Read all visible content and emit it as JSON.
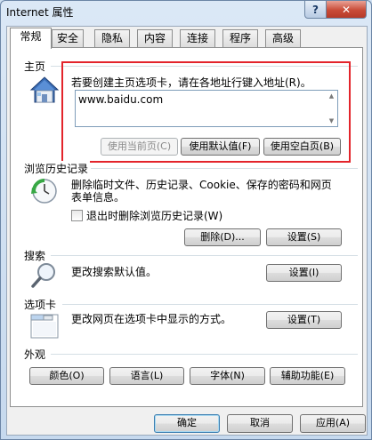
{
  "window": {
    "title": "Internet 属性",
    "help_label": "?",
    "close_label": "✕"
  },
  "tabs": [
    {
      "label": "常规",
      "active": true
    },
    {
      "label": "安全"
    },
    {
      "label": "隐私"
    },
    {
      "label": "内容"
    },
    {
      "label": "连接"
    },
    {
      "label": "程序"
    },
    {
      "label": "高级"
    }
  ],
  "home": {
    "section_label": "主页",
    "hint": "若要创建主页选项卡，请在各地址行键入地址(R)。",
    "url_value": "www.baidu.com",
    "btn_use_current": "使用当前页(C)",
    "btn_use_default": "使用默认值(F)",
    "btn_use_blank": "使用空白页(B)"
  },
  "history": {
    "section_label": "浏览历史记录",
    "description": "删除临时文件、历史记录、Cookie、保存的密码和网页表单信息。",
    "checkbox_label": "退出时删除浏览历史记录(W)",
    "checkbox_checked": false,
    "btn_delete": "删除(D)...",
    "btn_settings": "设置(S)"
  },
  "search": {
    "section_label": "搜索",
    "description": "更改搜索默认值。",
    "btn_settings": "设置(I)"
  },
  "tabs_section": {
    "section_label": "选项卡",
    "description": "更改网页在选项卡中显示的方式。",
    "btn_settings": "设置(T)"
  },
  "appearance": {
    "section_label": "外观",
    "btn_colors": "颜色(O)",
    "btn_languages": "语言(L)",
    "btn_fonts": "字体(N)",
    "btn_accessibility": "辅助功能(E)"
  },
  "footer": {
    "btn_ok": "确定",
    "btn_cancel": "取消",
    "btn_apply": "应用(A)"
  },
  "colors": {
    "highlight_box": "#e3242b",
    "window_frame": "#c6d9ee"
  }
}
